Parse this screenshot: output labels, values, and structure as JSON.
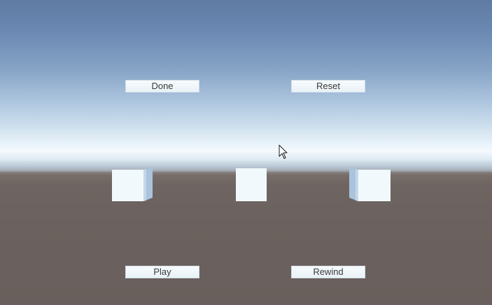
{
  "buttons": {
    "done": "Done",
    "reset": "Reset",
    "play": "Play",
    "rewind": "Rewind"
  },
  "colors": {
    "sky_top": "#5f7ba4",
    "horizon": "#f4f9fd",
    "ground": "#6b625f",
    "cube_face": "#f2f9fc",
    "cube_side": "#a9c4dc",
    "button_bg": "#f3f8fb",
    "button_text": "#3a3a3a"
  },
  "cursor": {
    "icon": "mouse-pointer-icon"
  }
}
